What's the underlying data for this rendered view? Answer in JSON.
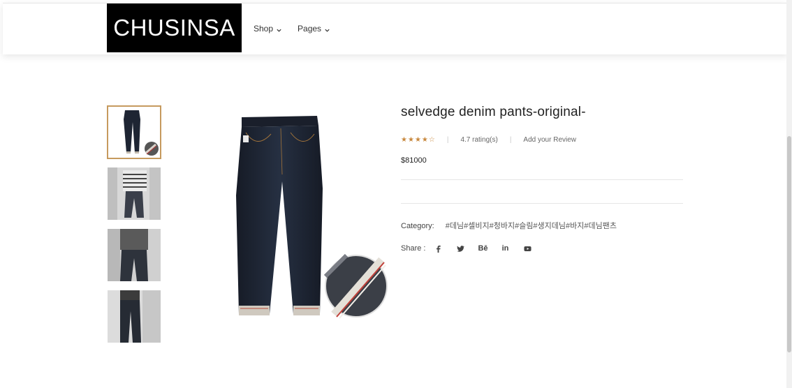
{
  "brand": {
    "logo_text": "CHUSINSA"
  },
  "nav": {
    "items": [
      {
        "label": "Shop"
      },
      {
        "label": "Pages"
      }
    ]
  },
  "product": {
    "title": "selvedge denim pants-original-",
    "rating": 4.7,
    "rating_max": 5,
    "rating_text": "4.7 rating(s)",
    "review_link": "Add your Review",
    "price": "$81000",
    "category_label": "Category:",
    "category_value": "#데님#셀비지#청바지#슬림#생지데님#바지#데님팬츠",
    "share_label": "Share :",
    "share_icons": [
      "facebook-icon",
      "twitter-icon",
      "behance-icon",
      "linkedin-icon",
      "youtube-icon"
    ],
    "behance_text": "Bē",
    "linkedin_text": "in"
  },
  "thumbnails": {
    "count": 4,
    "active_index": 0
  },
  "colors": {
    "accent": "#c69a5e",
    "star": "#c8883e",
    "logo_bg": "#000000",
    "denim": "#1e2533"
  }
}
